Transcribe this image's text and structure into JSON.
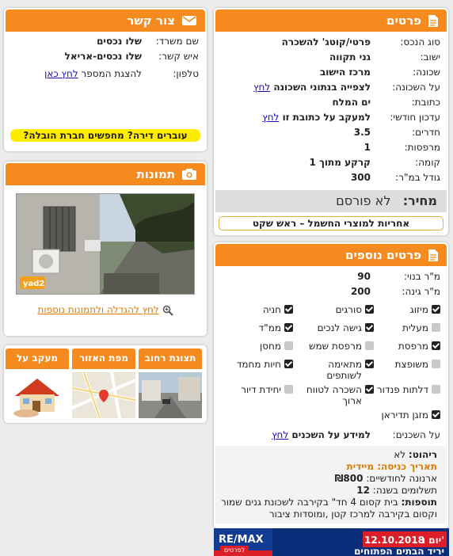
{
  "details": {
    "title": "פרטים",
    "rows": [
      {
        "label": "סוג הנכס:",
        "value": "פרטי/קוטג' להשכרה"
      },
      {
        "label": "ישוב:",
        "value": "גני תקווה"
      },
      {
        "label": "שכונה:",
        "value": "מרכז הישוב"
      },
      {
        "label": "על השכונה:",
        "value": "לצפייה בנתוני השכונה",
        "link": "לחץ"
      },
      {
        "label": "כתובת:",
        "value": "ים המלח"
      },
      {
        "label": "עדכון חודשי:",
        "value": "למעקב על כתובת זו",
        "link": "לחץ"
      },
      {
        "label": "חדרים:",
        "value": "3.5"
      },
      {
        "label": "מרפסות:",
        "value": "1"
      },
      {
        "label": "קומה:",
        "value": "קרקע מתוך 1"
      },
      {
        "label": "גודל במ\"ר:",
        "value": "300"
      }
    ],
    "price_label": "מחיר:",
    "price_value": "לא פורסם",
    "warranty": "אחריות למוצרי החשמל – ראש שקט"
  },
  "more": {
    "title": "פרטים נוספים",
    "rows": [
      {
        "label": "מ\"ר בנוי:",
        "value": "90"
      },
      {
        "label": "מ\"ר גינה:",
        "value": "200"
      }
    ],
    "features": [
      {
        "label": "מיזוג",
        "checked": true
      },
      {
        "label": "סורגים",
        "checked": true
      },
      {
        "label": "חניה",
        "checked": true
      },
      {
        "label": "מעלית",
        "checked": false
      },
      {
        "label": "גישה לנכים",
        "checked": true
      },
      {
        "label": "ממ\"ד",
        "checked": true
      },
      {
        "label": "מרפסת",
        "checked": true
      },
      {
        "label": "מרפסת שמש",
        "checked": false
      },
      {
        "label": "מחסן",
        "checked": false
      },
      {
        "label": "משופצת",
        "checked": false
      },
      {
        "label": "מתאימה לשותפים",
        "checked": true
      },
      {
        "label": "חיות מחמד",
        "checked": true
      },
      {
        "label": "דלתות פנדור",
        "checked": false
      },
      {
        "label": "השכרה לטווח ארוך",
        "checked": true
      },
      {
        "label": "יחידת דיור",
        "checked": false
      },
      {
        "label": "מזגן תדיראן",
        "checked": true
      }
    ],
    "neighbors_label": "על השכנים:",
    "neighbors_value": "למידע על השכנים",
    "neighbors_link": "לחץ",
    "furniture_label": "ריהוט:",
    "furniture_value": "לא",
    "entry_label": "תאריך כניסה:",
    "entry_value": "מיידית",
    "arnona_label": "ארנונה לחודשיים:",
    "arnona_value": "₪800",
    "payments_label": "תשלומים בשנה:",
    "payments_value": "12",
    "more_label": "תוספות:",
    "more_value": "בית קסום 4 חד\" בקירבה לשכונת גנים שמור וקסום בקירבה למרכז קטן ,ומוסדות ציבור"
  },
  "contact": {
    "title": "צור קשר",
    "office_label": "שם משרד:",
    "office_value": "שלו נכסים",
    "person_label": "איש קשר:",
    "person_value": "שלו נכסים-אריאל",
    "phone_label": "טלפון:",
    "phone_text": "להצגת המספר",
    "phone_link": "לחץ כאן",
    "movers": "עוברים דירה? מחפשים חברת הובלה?"
  },
  "photos": {
    "title": "תמונות",
    "watermark": "yad2",
    "enlarge": "לחץ להגדלה ולתמונות נוספות"
  },
  "tabs": [
    {
      "label": "תצוגת רחוב"
    },
    {
      "label": "מפת האזור"
    },
    {
      "label": "מעקב על הנכס"
    }
  ],
  "banner": {
    "brand": "RE/MAX",
    "date": "12.10.2018",
    "day": "יום ו'",
    "event": "יריד הבתים הפתוחים",
    "cta": "לפרטים"
  },
  "colors": {
    "accent": "#f58a1f",
    "highlight": "#ffeb00",
    "link": "#1a0dab"
  }
}
